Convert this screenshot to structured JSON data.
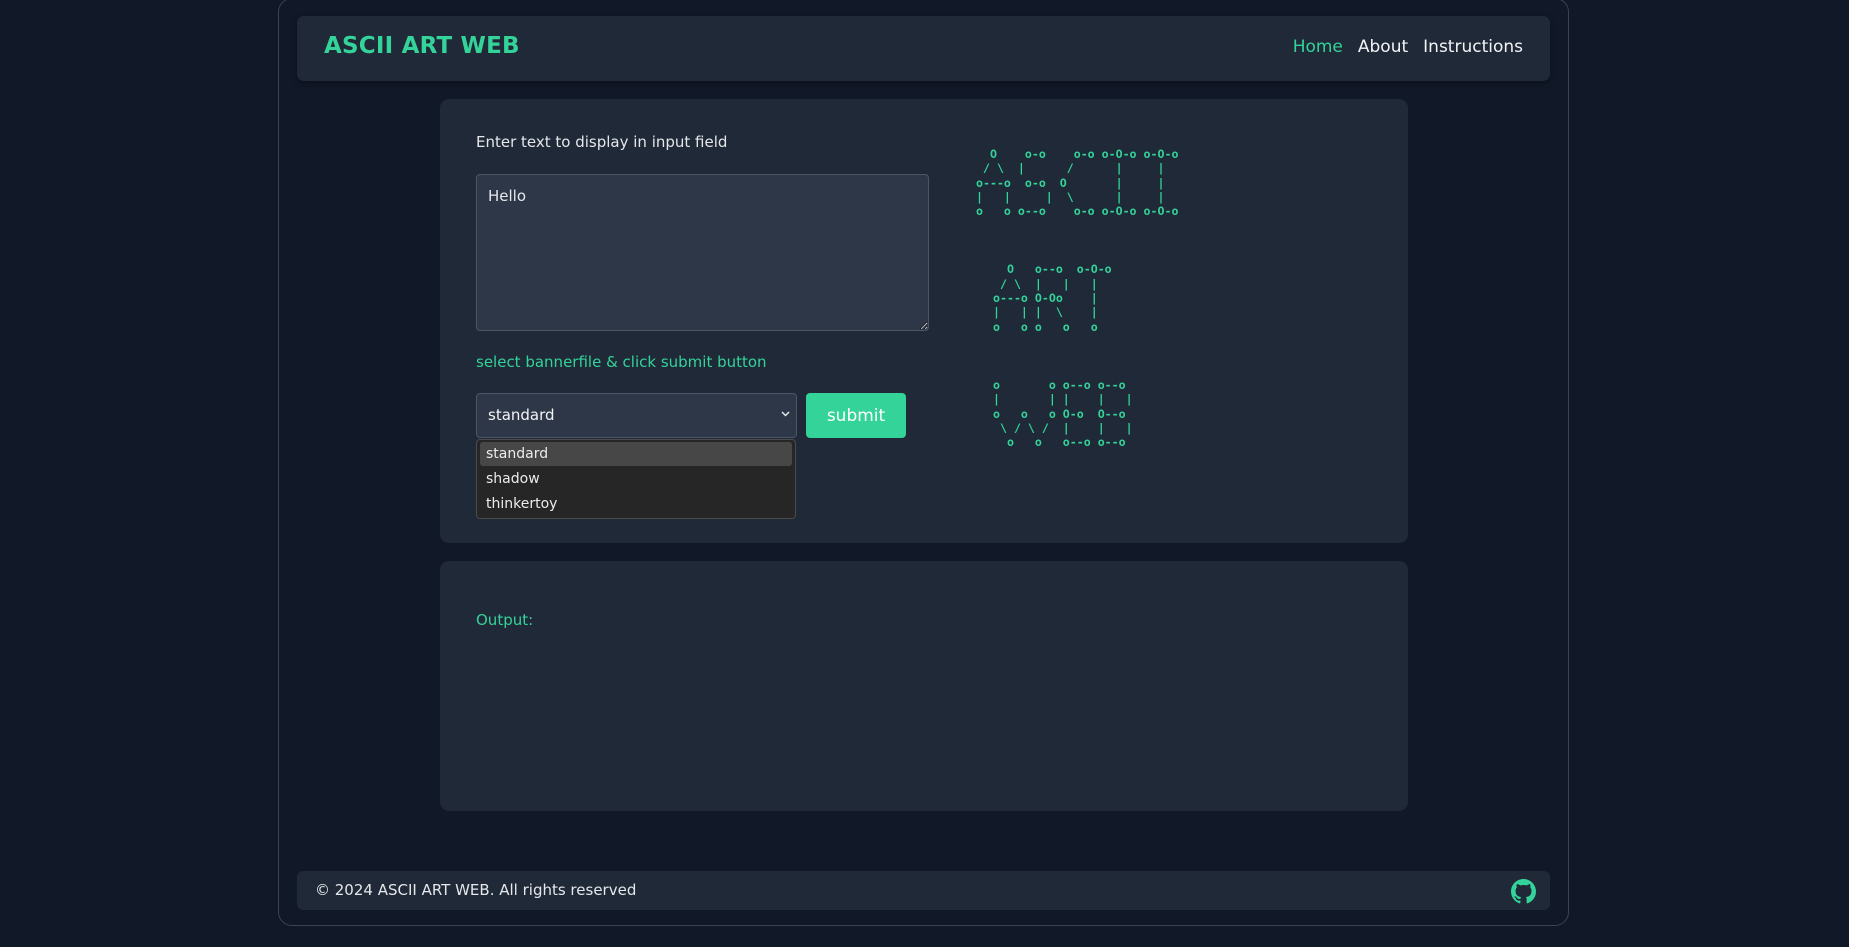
{
  "header": {
    "brand": "ASCII ART WEB",
    "nav": [
      {
        "label": "Home",
        "active": true
      },
      {
        "label": "About",
        "active": false
      },
      {
        "label": "Instructions",
        "active": false
      }
    ]
  },
  "form": {
    "prompt_label": "Enter text to display in input field",
    "text_value": "Hello",
    "banner_label": "select bannerfile & click submit button",
    "select_value": "standard",
    "options": [
      "standard",
      "shadow",
      "thinkertoy"
    ],
    "highlighted_option": "standard",
    "submit_label": "submit"
  },
  "ascii_logo": {
    "lines": [
      [
        "  O    o-o    o-o o-O-o o-O-o",
        " / \\  |      /      |     |  ",
        "o---o  o-o  O       |     |  ",
        "|   |     |  \\      |     |  ",
        "o   o o--o    o-o o-O-o o-O-o"
      ],
      [
        "  O   o--o  o-O-o",
        " / \\  |   |   |  ",
        "o---o O-Oo    |  ",
        "|   | |  \\    |  ",
        "o   o o   o   o  "
      ],
      [
        "o       o o--o o--o ",
        "|       | |    |   |",
        "o   o   o O-o  O--o ",
        " \\ / \\ /  |    |   |",
        "  o   o   o--o o--o "
      ]
    ]
  },
  "output": {
    "label": "Output:",
    "value": ""
  },
  "footer": {
    "copyright": "© 2024 ASCII ART WEB. All rights reserved",
    "icon": "github-icon"
  },
  "colors": {
    "accent": "#34d399",
    "background": "#111827",
    "card": "#1f2937",
    "input": "#2e3748"
  }
}
